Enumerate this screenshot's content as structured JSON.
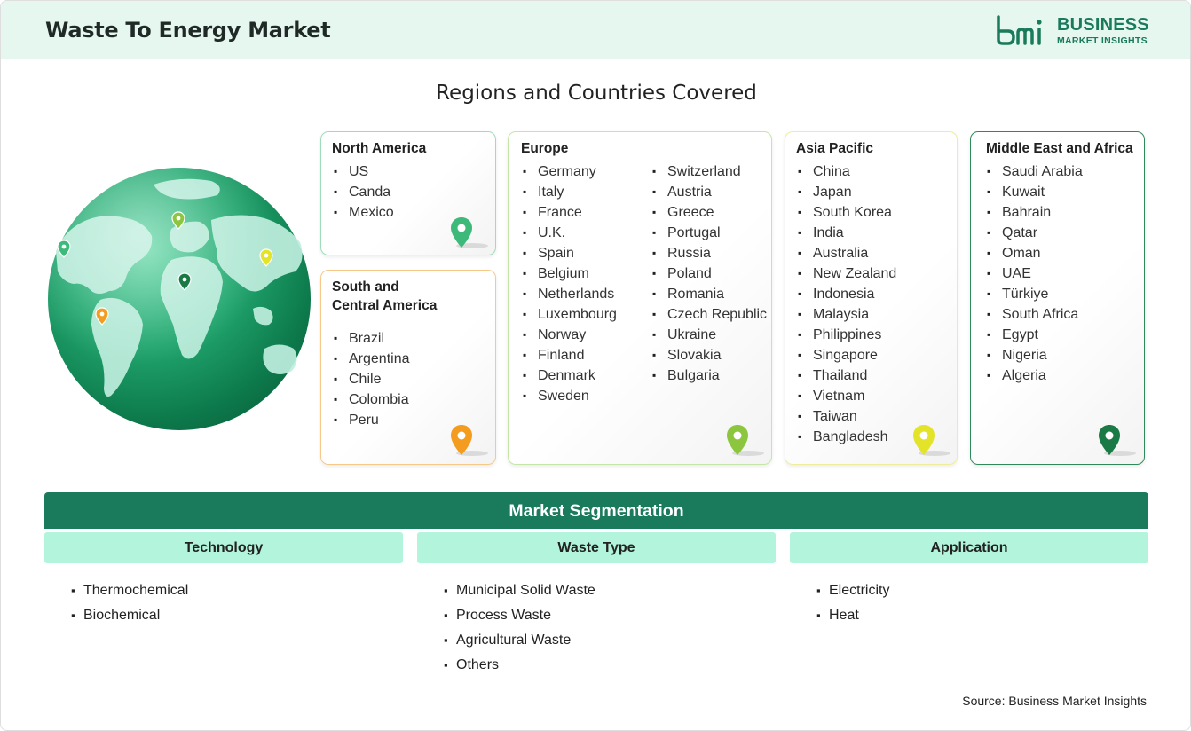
{
  "header": {
    "title": "Waste To Energy Market",
    "logo_line1": "BUSINESS",
    "logo_line2": "MARKET INSIGHTS",
    "logo_mark_text": "bmi"
  },
  "regions_title": "Regions and Countries Covered",
  "regions": {
    "north_america": {
      "title": "North America",
      "items": [
        "US",
        "Canda",
        "Mexico"
      ],
      "color": "#3dba7a",
      "pin_icon": "location-pin-icon"
    },
    "south_central_america": {
      "title_line1": "South and",
      "title_line2": "Central America",
      "items": [
        "Brazil",
        "Argentina",
        "Chile",
        "Colombia",
        "Peru"
      ],
      "color": "#f39c1f",
      "pin_icon": "location-pin-icon"
    },
    "europe": {
      "title": "Europe",
      "items_col1": [
        "Germany",
        "Italy",
        "France",
        "U.K.",
        "Spain",
        "Belgium",
        "Netherlands",
        "Luxembourg",
        "Norway",
        "Finland",
        "Denmark",
        "Sweden"
      ],
      "items_col2": [
        "Switzerland",
        "Austria",
        "Greece",
        "Portugal",
        "Russia",
        "Poland",
        "Romania",
        "Czech Republic",
        "Ukraine",
        "Slovakia",
        "Bulgaria"
      ],
      "color": "#8cc63f",
      "pin_icon": "location-pin-icon"
    },
    "asia_pacific": {
      "title": "Asia Pacific",
      "items": [
        "China",
        "Japan",
        "South Korea",
        "India",
        "Australia",
        "New Zealand",
        "Indonesia",
        "Malaysia",
        "Philippines",
        "Singapore",
        "Thailand",
        "Vietnam",
        "Taiwan",
        "Bangladesh"
      ],
      "color": "#e3e42a",
      "pin_icon": "location-pin-icon"
    },
    "middle_east_africa": {
      "title": "Middle East and Africa",
      "items": [
        "Saudi Arabia",
        "Kuwait",
        "Bahrain",
        "Qatar",
        "Oman",
        "UAE",
        "Türkiye",
        "South Africa",
        "Egypt",
        "Nigeria",
        "Algeria"
      ],
      "color": "#1a7a45",
      "pin_icon": "location-pin-icon"
    }
  },
  "segmentation": {
    "title": "Market Segmentation",
    "columns": [
      {
        "header": "Technology",
        "items": [
          "Thermochemical",
          "Biochemical"
        ]
      },
      {
        "header": "Waste Type",
        "items": [
          "Municipal Solid Waste",
          "Process Waste",
          "Agricultural Waste",
          "Others"
        ]
      },
      {
        "header": "Application",
        "items": [
          "Electricity",
          "Heat"
        ]
      }
    ]
  },
  "source": "Source: Business Market Insights",
  "colors": {
    "brand": "#1a7a5c",
    "header_bg": "#e6f7ef",
    "segment_header_bg": "#b2f5dc"
  }
}
